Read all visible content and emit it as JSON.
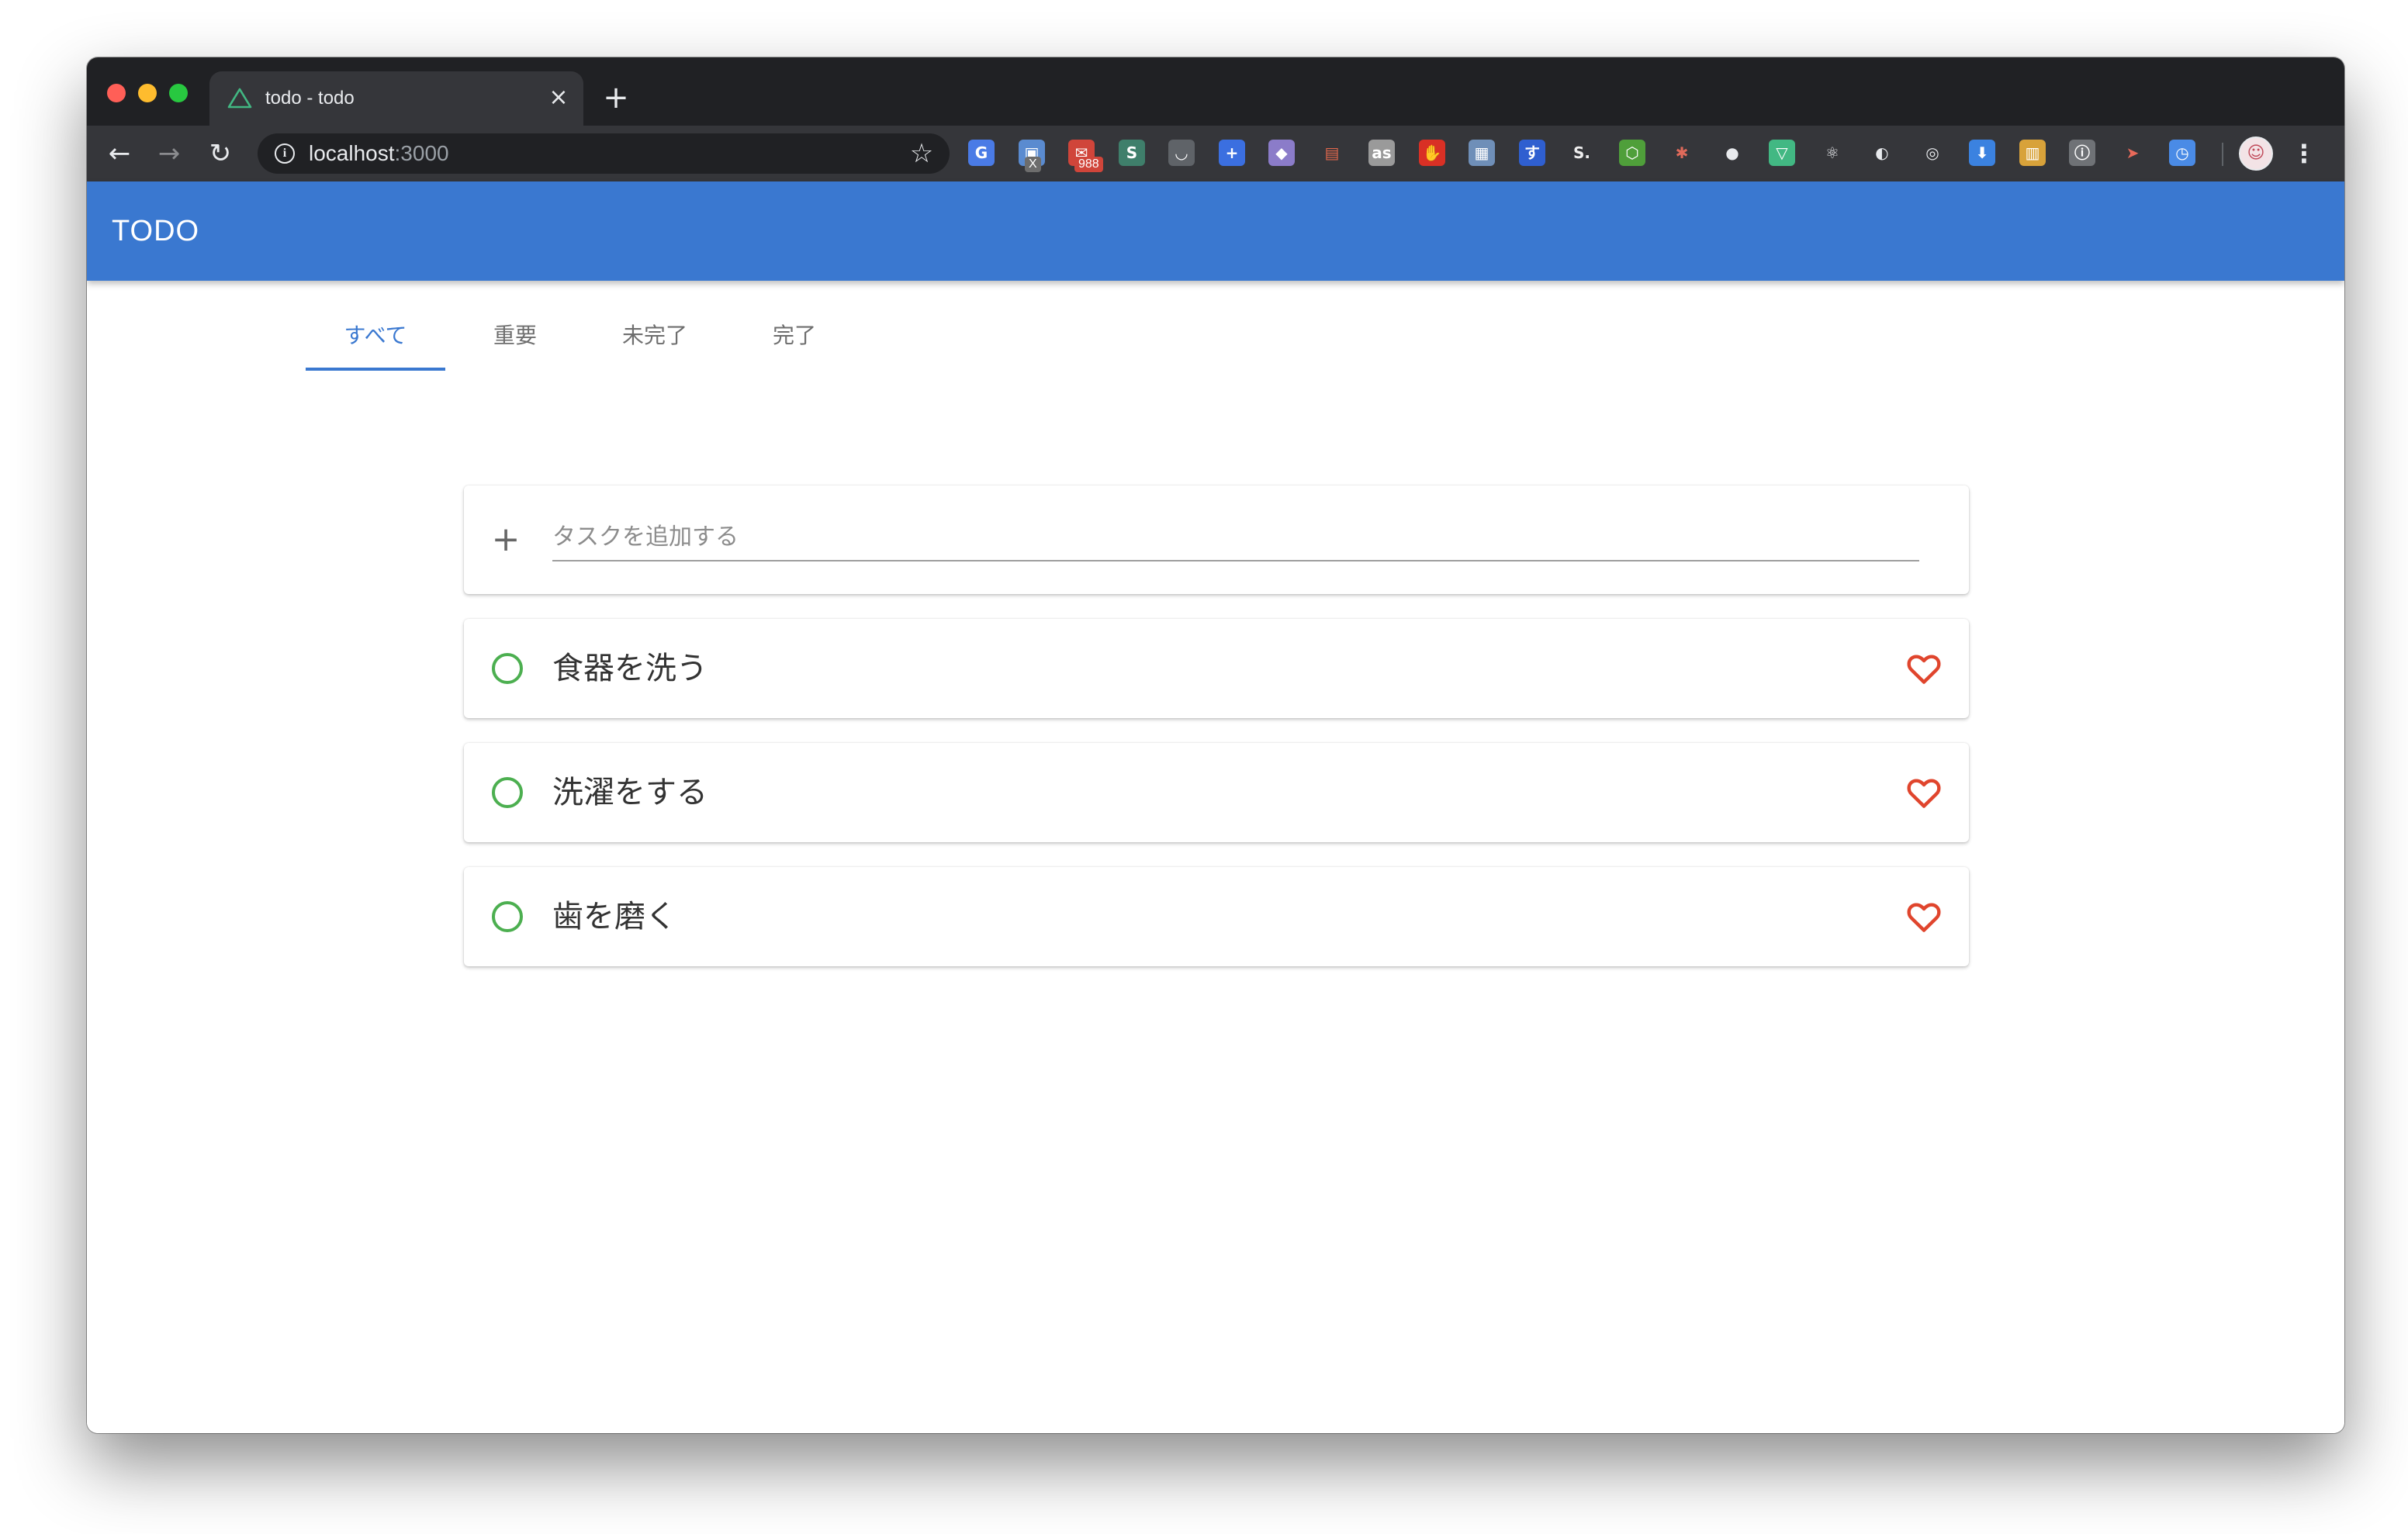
{
  "browser": {
    "tab_title": "todo - todo",
    "tab_close": "×",
    "new_tab": "+",
    "nav": {
      "back": "←",
      "forward": "→",
      "reload": "↻"
    },
    "url_host": "localhost",
    "url_port": ":3000",
    "bookmark_icon": "☆",
    "extensions": [
      {
        "name": "translate-icon",
        "glyph": "G",
        "color": "#4a7be6"
      },
      {
        "name": "window-ext-icon",
        "glyph": "▣",
        "color": "#5a8bd0",
        "badge": "X",
        "badge_color": "#6d6d6d"
      },
      {
        "name": "mail-icon",
        "glyph": "✉",
        "color": "#d0453a",
        "badge": "988",
        "badge_color": "#d0453a"
      },
      {
        "name": "s-ext-icon",
        "glyph": "S",
        "color": "#3f7f6b"
      },
      {
        "name": "pocket-icon",
        "glyph": "◡",
        "color": "#5f6368"
      },
      {
        "name": "plus-ext-icon",
        "glyph": "+",
        "color": "#3b6fe0"
      },
      {
        "name": "github-cat-icon",
        "glyph": "◆",
        "color": "#8b7cc9"
      },
      {
        "name": "photo-ext-icon",
        "glyph": "▤",
        "color": "#e0674c"
      },
      {
        "name": "lastfm-icon",
        "glyph": "as",
        "color": "#9a9a9a"
      },
      {
        "name": "stop-hand-icon",
        "glyph": "✋",
        "color": "#d93025"
      },
      {
        "name": "printer-ext-icon",
        "glyph": "▦",
        "color": "#6f8fb8"
      },
      {
        "name": "su-ext-icon",
        "glyph": "す",
        "color": "#2f5fd0"
      },
      {
        "name": "s-dot-icon",
        "glyph": "S.",
        "color": "#eeeeee"
      },
      {
        "name": "node-icon",
        "glyph": "⬡",
        "color": "#4f9f3a"
      },
      {
        "name": "asterisk-ext-icon",
        "glyph": "✱",
        "color": "#e06a5a"
      },
      {
        "name": "circle-ext-icon",
        "glyph": "●",
        "color": "#e8eaed"
      },
      {
        "name": "vue-icon",
        "glyph": "▽",
        "color": "#42b883"
      },
      {
        "name": "react-icon",
        "glyph": "⚛",
        "color": "#e8eaed"
      },
      {
        "name": "moon-ext-icon",
        "glyph": "◐",
        "color": "#e8eaed"
      },
      {
        "name": "target-ext-icon",
        "glyph": "◎",
        "color": "#e8eaed"
      },
      {
        "name": "download-ext-icon",
        "glyph": "⬇",
        "color": "#3b82e0"
      },
      {
        "name": "books-ext-icon",
        "glyph": "▥",
        "color": "#d8a23a"
      },
      {
        "name": "info-ext-icon",
        "glyph": "ⓘ",
        "color": "#6f7276"
      },
      {
        "name": "share-ext-icon",
        "glyph": "➤",
        "color": "#e86a5a"
      },
      {
        "name": "clock-ext-icon",
        "glyph": "◷",
        "color": "#4a8be6"
      }
    ],
    "avatar": "☺",
    "menu": "⋮"
  },
  "app": {
    "title": "TODO",
    "tabs": [
      {
        "label": "すべて",
        "active": true
      },
      {
        "label": "重要",
        "active": false
      },
      {
        "label": "未完了",
        "active": false
      },
      {
        "label": "完了",
        "active": false
      }
    ],
    "add_task": {
      "icon": "+",
      "placeholder": "タスクを追加する",
      "value": ""
    },
    "tasks": [
      {
        "label": "食器を洗う",
        "done": false,
        "important": false
      },
      {
        "label": "洗濯をする",
        "done": false,
        "important": false
      },
      {
        "label": "歯を磨く",
        "done": false,
        "important": false
      }
    ]
  },
  "colors": {
    "appbar": "#3a78d0",
    "accent": "#3a78d0",
    "check": "#4caf50",
    "heart": "#e0452d"
  }
}
